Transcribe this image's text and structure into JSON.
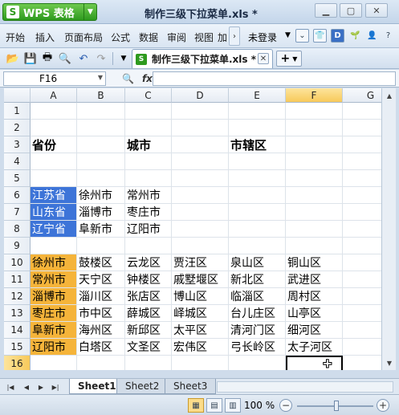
{
  "app": {
    "name": "WPS 表格",
    "logo_letter": "S",
    "document_title": "制作三级下拉菜单.xls *"
  },
  "menu": [
    "开始",
    "插入",
    "页面布局",
    "公式",
    "数据",
    "审阅",
    "视图",
    "加"
  ],
  "login_label": "未登录",
  "tab": {
    "label": "制作三级下拉菜单.xls *"
  },
  "formula_bar": {
    "cell_ref": "F16",
    "formula": ""
  },
  "columns": [
    "A",
    "B",
    "C",
    "D",
    "E",
    "F",
    "G"
  ],
  "rows": [
    "1",
    "2",
    "3",
    "4",
    "5",
    "6",
    "7",
    "8",
    "9",
    "10",
    "11",
    "12",
    "13",
    "14",
    "15",
    "16",
    "17"
  ],
  "active_column": "F",
  "active_row": "16",
  "cells": {
    "row3": {
      "A": "省份",
      "C": "城市",
      "E": "市辖区"
    },
    "row6": {
      "A": "江苏省",
      "B": "徐州市",
      "C": "常州市"
    },
    "row7": {
      "A": "山东省",
      "B": "淄博市",
      "C": "枣庄市"
    },
    "row8": {
      "A": "辽宁省",
      "B": "阜新市",
      "C": "辽阳市"
    },
    "row10": {
      "A": "徐州市",
      "B": "鼓楼区",
      "C": "云龙区",
      "D": "贾汪区",
      "E": "泉山区",
      "F": "铜山区"
    },
    "row11": {
      "A": "常州市",
      "B": "天宁区",
      "C": "钟楼区",
      "D": "戚墅堰区",
      "E": "新北区",
      "F": "武进区"
    },
    "row12": {
      "A": "淄博市",
      "B": "淄川区",
      "C": "张店区",
      "D": "博山区",
      "E": "临淄区",
      "F": "周村区"
    },
    "row13": {
      "A": "枣庄市",
      "B": "市中区",
      "C": "薛城区",
      "D": "峄城区",
      "E": "台儿庄区",
      "F": "山亭区"
    },
    "row14": {
      "A": "阜新市",
      "B": "海州区",
      "C": "新邱区",
      "D": "太平区",
      "E": "清河门区",
      "F": "细河区"
    },
    "row15": {
      "A": "辽阳市",
      "B": "白塔区",
      "C": "文圣区",
      "D": "宏伟区",
      "E": "弓长岭区",
      "F": "太子河区"
    }
  },
  "sheets": [
    "Sheet1",
    "Sheet2",
    "Sheet3"
  ],
  "active_sheet": "Sheet1",
  "zoom": "100 %",
  "colors": {
    "province_fill": "#3d74d8",
    "city_fill": "#f5b43a"
  }
}
